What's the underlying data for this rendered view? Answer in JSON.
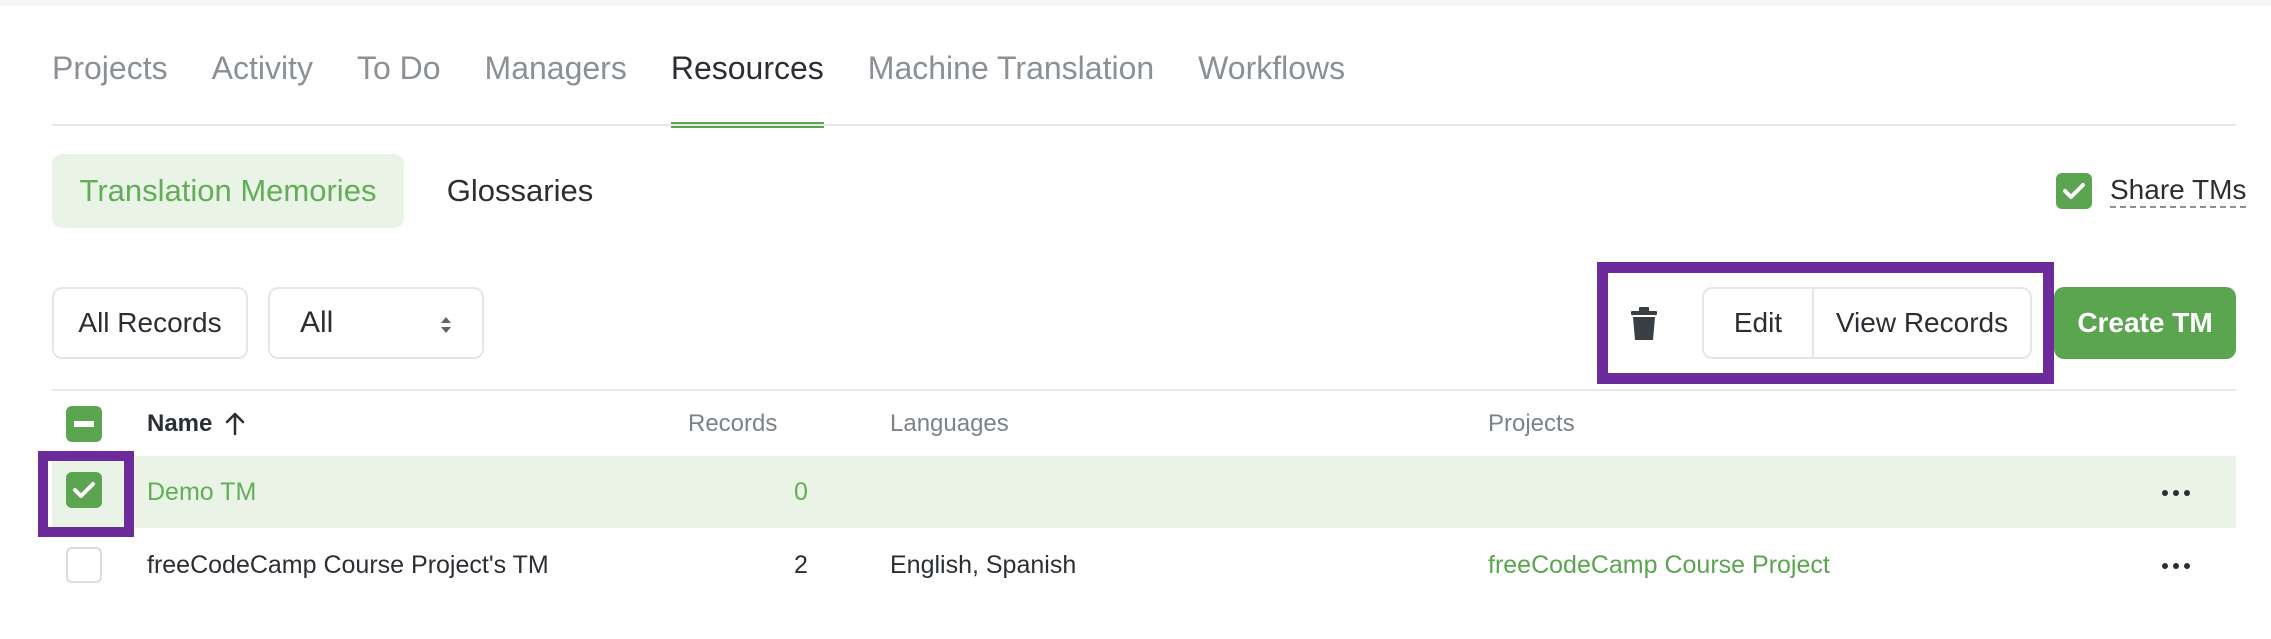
{
  "main_tabs": [
    {
      "label": "Projects",
      "active": false
    },
    {
      "label": "Activity",
      "active": false
    },
    {
      "label": "To Do",
      "active": false
    },
    {
      "label": "Managers",
      "active": false
    },
    {
      "label": "Resources",
      "active": true
    },
    {
      "label": "Machine Translation",
      "active": false
    },
    {
      "label": "Workflows",
      "active": false
    }
  ],
  "sub_tabs": {
    "translation_memories": "Translation Memories",
    "glossaries": "Glossaries",
    "active": "translation_memories"
  },
  "share": {
    "label": "Share TMs",
    "checked": true
  },
  "toolbar": {
    "all_records": "All Records",
    "filter_value": "All",
    "edit": "Edit",
    "view_records": "View Records",
    "create": "Create TM"
  },
  "table": {
    "columns": {
      "name": "Name",
      "records": "Records",
      "languages": "Languages",
      "projects": "Projects"
    },
    "sort": "name-ascending",
    "rows": [
      {
        "name": "Demo TM",
        "records": "0",
        "languages": "",
        "projects": "",
        "selected": true
      },
      {
        "name": "freeCodeCamp Course Project's TM",
        "records": "2",
        "languages": "English, Spanish",
        "projects": "freeCodeCamp Course Project",
        "selected": false
      }
    ]
  },
  "colors": {
    "accent": "#5ba450",
    "accent_light": "#e9f4e7",
    "highlight": "#6b2b9a"
  }
}
